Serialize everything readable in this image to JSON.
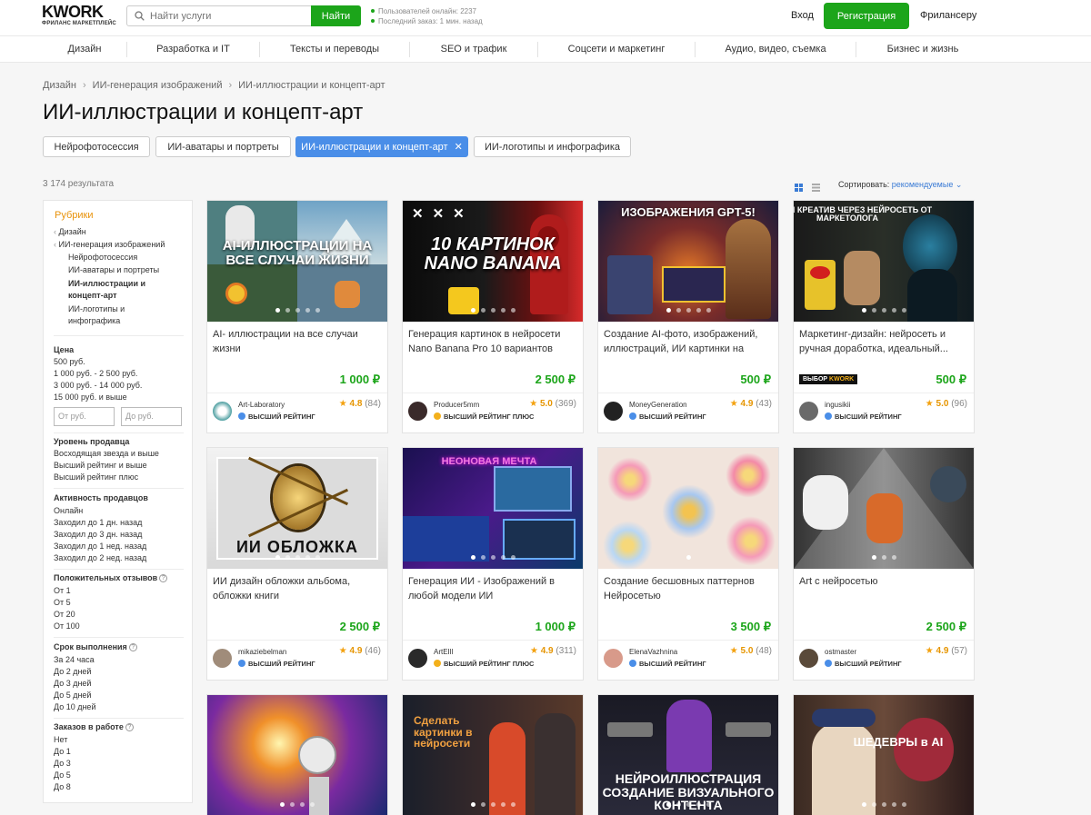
{
  "header": {
    "logo": "KWORK",
    "logo_sub": "ФРИЛАНС МАРКЕТПЛЕЙС",
    "search_placeholder": "Найти услуги",
    "search_button": "Найти",
    "stats_online": "Пользователей онлайн: 2237",
    "stats_last_order": "Последний заказ: 1 мин. назад",
    "login": "Вход",
    "register": "Регистрация",
    "freelancer": "Фрилансеру"
  },
  "nav": [
    "Дизайн",
    "Разработка и IT",
    "Тексты и переводы",
    "SEO и трафик",
    "Соцсети и маркетинг",
    "Аудио, видео, съемка",
    "Бизнес и жизнь"
  ],
  "breadcrumb": [
    "Дизайн",
    "ИИ-генерация изображений",
    "ИИ-иллюстрации и концепт-арт"
  ],
  "page_title": "ИИ-иллюстрации и концепт-арт",
  "chips": [
    "Нейрофотосессия",
    "ИИ-аватары и портреты",
    "ИИ-иллюстрации и концепт-арт",
    "ИИ-логотипы и инфографика"
  ],
  "chip_close": "✕",
  "results": "3 174 результата",
  "sort_label": "Сортировать:",
  "sort_value": "рекомендуемые",
  "sidebar": {
    "title": "Рубрики",
    "rubrics": [
      "Дизайн",
      "ИИ-генерация изображений",
      "Нейрофотосессия",
      "ИИ-аватары и портреты",
      "ИИ-иллюстрации и",
      "концепт-арт",
      "ИИ-логотипы и",
      "инфографика"
    ],
    "price_title": "Цена",
    "prices": [
      "500 руб.",
      "1 000 руб. - 2 500 руб.",
      "3 000 руб. - 14 000 руб.",
      "15 000 руб. и выше"
    ],
    "price_from": "От руб.",
    "price_to": "До руб.",
    "level_title": "Уровень продавца",
    "levels": [
      "Восходящая звезда и выше",
      "Высший рейтинг и выше",
      "Высший рейтинг плюс"
    ],
    "activity_title": "Активность продавцов",
    "activity": [
      "Онлайн",
      "Заходил до 1 дн. назад",
      "Заходил до 3 дн. назад",
      "Заходил до 1 нед. назад",
      "Заходил до 2 нед. назад"
    ],
    "reviews_title": "Положительных отзывов",
    "reviews": [
      "От 1",
      "От 5",
      "От 20",
      "От 100"
    ],
    "term_title": "Срок выполнения",
    "terms": [
      "За 24 часа",
      "До 2 дней",
      "До 3 дней",
      "До 5 дней",
      "До 10 дней"
    ],
    "orders_title": "Заказов в работе",
    "orders": [
      "Нет",
      "До 1",
      "До 3",
      "До 5",
      "До 8"
    ]
  },
  "cards": [
    {
      "image_text": "AI-ИЛЛЮСТРАЦИИ НА ВСЕ СЛУЧАИ ЖИЗНИ",
      "title": "AI- иллюстрации на все случаи жизни",
      "price": "1 000 ₽",
      "seller": "Art-Laboratory",
      "rank": "ВЫСШИЙ РЕЙТИНГ",
      "rating": "4.8",
      "reviews": "(84)"
    },
    {
      "image_text": "10 КАРТИНОК NANO BANANA",
      "title": "Генерация картинок в нейросети Nano Banana Pro 10 вариантов",
      "price": "2 500 ₽",
      "seller": "Producer5mm",
      "rank": "ВЫСШИЙ РЕЙТИНГ ПЛЮС",
      "rating": "5.0",
      "reviews": "(369)"
    },
    {
      "image_text": "ИЗОБРАЖЕНИЯ GPT-5!",
      "title": "Создание AI-фото, изображений, иллюстраций, ИИ картинки на заказ...",
      "price": "500 ₽",
      "seller": "MoneyGeneration",
      "rank": "ВЫСШИЙ РЕЙТИНГ",
      "rating": "4.9",
      "reviews": "(43)"
    },
    {
      "image_text": "ЛЮБОЙ КРЕАТИВ ЧЕРЕЗ НЕЙРОСЕТЬ ОТ МАРКЕТОЛОГА",
      "title": "Маркетинг-дизайн: нейросеть и ручная доработка, идеальный...",
      "price": "500 ₽",
      "badge": "ВЫБОР",
      "badge_brand": "KWORK",
      "seller": "ingusikii",
      "rank": "ВЫСШИЙ РЕЙТИНГ",
      "rating": "5.0",
      "reviews": "(96)"
    },
    {
      "image_text": "ИИ ОБЛОЖКА",
      "title": "ИИ дизайн обложки альбома, обложки книги",
      "price": "2 500 ₽",
      "seller": "mikaziebelman",
      "rank": "ВЫСШИЙ РЕЙТИНГ",
      "rating": "4.9",
      "reviews": "(46)"
    },
    {
      "image_text": "НЕОНОВАЯ МЕЧТА",
      "title": "Генерация ИИ - Изображений в любой модели ИИ",
      "price": "1 000 ₽",
      "seller": "ArtEIll",
      "rank": "ВЫСШИЙ РЕЙТИНГ ПЛЮС",
      "rating": "4.9",
      "reviews": "(311)"
    },
    {
      "image_text": "",
      "title": "Создание бесшовных паттернов Нейросетью",
      "price": "3 500 ₽",
      "seller": "ElenaVazhnina",
      "rank": "ВЫСШИЙ РЕЙТИНГ",
      "rating": "5.0",
      "reviews": "(48)"
    },
    {
      "image_text": "",
      "title": "Art с нейросетью",
      "price": "2 500 ₽",
      "seller": "ostmaster",
      "rank": "ВЫСШИЙ РЕЙТИНГ",
      "rating": "4.9",
      "reviews": "(57)"
    },
    {
      "image_text": ""
    },
    {
      "image_text": "Сделать картинки в нейросети"
    },
    {
      "image_text": "НЕЙРОИЛЛЮСТРАЦИЯ СОЗДАНИЕ ВИЗУАЛЬНОГО КОНТЕНТА"
    },
    {
      "image_text": "ШЕДЕВРЫ в AI"
    }
  ],
  "colors": {
    "green": "#1ca51a",
    "blue": "#4a8ee8",
    "orange": "#e8920a",
    "star": "#f3a10f"
  }
}
